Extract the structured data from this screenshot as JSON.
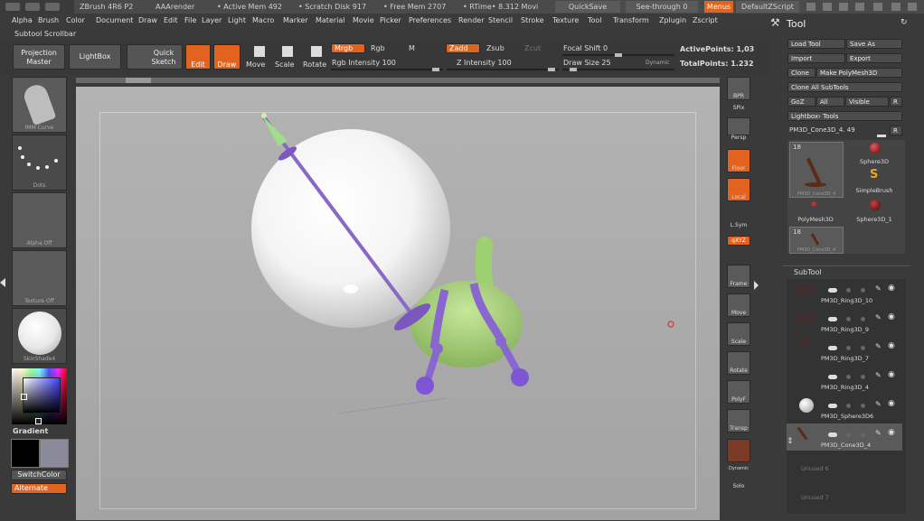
{
  "title_bar": {
    "app": "ZBrush 4R6 P2",
    "render": "AAArender",
    "active_mem": "• Active Mem 492",
    "scratch": "• Scratch Disk 917",
    "free_mem": "• Free Mem 2707",
    "rtime": "• RTime• 8.312 Movi",
    "quicksave": "QuickSave",
    "seethrough": "See-through  0",
    "menus": "Menus",
    "script": "DefaultZScript"
  },
  "menu": [
    "Alpha",
    "Brush",
    "Color",
    "Document",
    "Draw",
    "Edit",
    "File",
    "Layer",
    "Light",
    "Macro",
    "Marker",
    "Material",
    "Movie",
    "Picker",
    "Preferences",
    "Render",
    "Stencil",
    "Stroke",
    "Texture",
    "Tool",
    "Transform",
    "Zplugin",
    "Zscript"
  ],
  "subtool_scrollbar": "Subtool Scrollbar",
  "toolbar": {
    "projection_master": "Projection Master",
    "lightbox": "LightBox",
    "quick_sketch": "Quick Sketch",
    "edit": "Edit",
    "draw": "Draw",
    "move": "Move",
    "scale": "Scale",
    "rotate": "Rotate",
    "mrgb": "Mrgb",
    "rgb": "Rgb",
    "m": "M",
    "zadd": "Zadd",
    "zsub": "Zsub",
    "zcut": "Zcut",
    "rgb_intensity": "Rgb Intensity 100",
    "z_intensity": "Z Intensity 100",
    "focal_shift": "Focal Shift 0",
    "draw_size": "Draw Size 25",
    "dynamic": "Dynamic",
    "active_points": "ActivePoints: 1,03",
    "total_points": "TotalPoints: 1.232"
  },
  "left_panel": {
    "brush": "IMM Curve",
    "stroke": "Dots",
    "alpha": "Alpha Off",
    "texture": "Texture Off",
    "material": "SkinShade4",
    "gradient": "Gradient",
    "switch_color": "SwitchColor",
    "alternate": "Alternate"
  },
  "right_strip": [
    "BPR",
    "SPix",
    "Persp",
    "Floor",
    "Local",
    "L.Sym",
    "qXYZ",
    "Frame",
    "Move",
    "Scale",
    "Rotate",
    "PolyF",
    "Transp",
    "Dynamic",
    "Solo"
  ],
  "tool_panel": {
    "title": "Tool",
    "load_tool": "Load Tool",
    "save_as": "Save As",
    "import": "Import",
    "export": "Export",
    "clone": "Clone",
    "make_polymesh": "Make PolyMesh3D",
    "clone_all": "Clone All SubTools",
    "goz": "GoZ",
    "all": "All",
    "visible": "Visible",
    "r": "R",
    "lightbox_tools": "Lightbox› Tools",
    "current_tool": "PM3D_Cone3D_4. 49",
    "thumb_count": "18",
    "tools": [
      "PM3D_Cone3D_4",
      "Sphere3D",
      "SimpleBrush",
      "PolyMesh3D",
      "Sphere3D_1",
      "PM3D_Cone3D_4"
    ],
    "subtool_header": "SubTool",
    "subtools": [
      "PM3D_Ring3D_10",
      "PM3D_Ring3D_9",
      "PM3D_Ring3D_7",
      "PM3D_Ring3D_4",
      "PM3D_Sphere3D6",
      "PM3D_Cone3D_4"
    ],
    "unused": [
      "Unused 6",
      "Unused 7"
    ]
  },
  "colors": {
    "accent": "#e2621f",
    "panel": "#3a3a3a",
    "viewport": "#ababab"
  }
}
